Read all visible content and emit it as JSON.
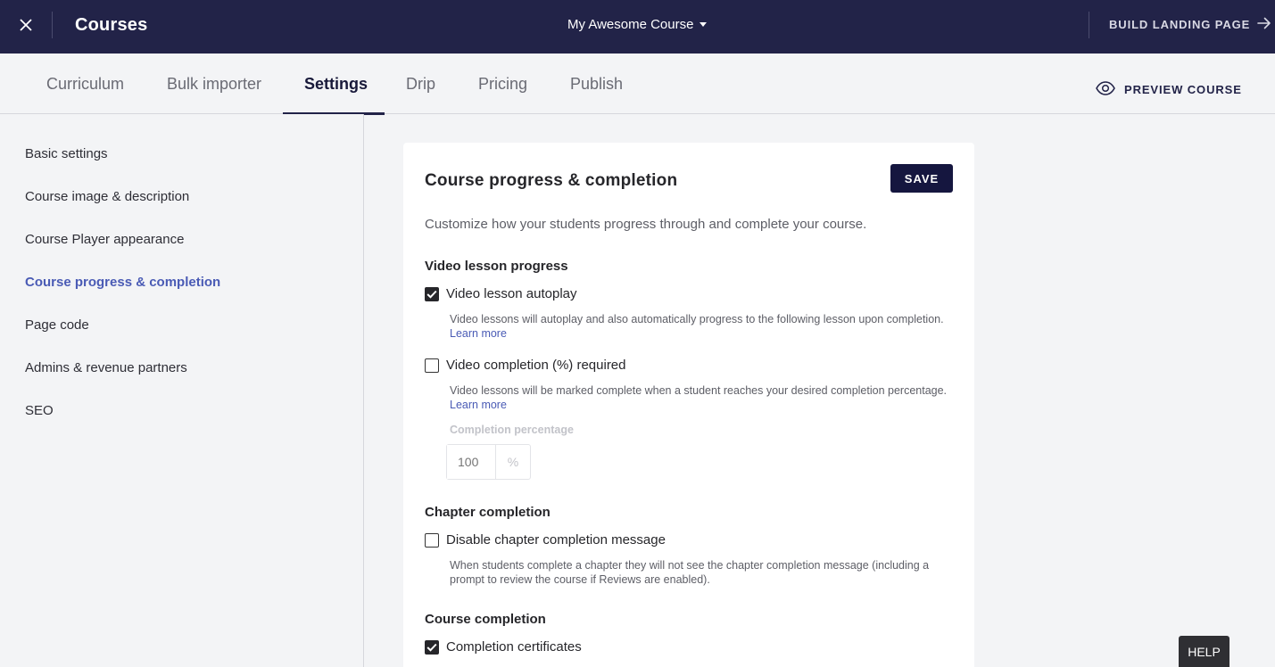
{
  "topbar": {
    "title": "Courses",
    "course_select": "My Awesome Course",
    "build_landing": "BUILD LANDING PAGE"
  },
  "tabs": [
    {
      "label": "Curriculum"
    },
    {
      "label": "Bulk importer"
    },
    {
      "label": "Settings"
    },
    {
      "label": "Drip"
    },
    {
      "label": "Pricing"
    },
    {
      "label": "Publish"
    }
  ],
  "active_tab": "Settings",
  "preview_label": "PREVIEW COURSE",
  "sidebar": {
    "items": [
      {
        "label": "Basic settings"
      },
      {
        "label": "Course image & description"
      },
      {
        "label": "Course Player appearance"
      },
      {
        "label": "Course progress & completion"
      },
      {
        "label": "Page code"
      },
      {
        "label": "Admins & revenue partners"
      },
      {
        "label": "SEO"
      }
    ],
    "active": "Course progress & completion"
  },
  "card": {
    "title": "Course progress & completion",
    "save_label": "SAVE",
    "description": "Customize how your students progress through and complete your course.",
    "video_section": {
      "title": "Video lesson progress",
      "autoplay": {
        "label": "Video lesson autoplay",
        "checked": true,
        "help": "Video lessons will autoplay and also automatically progress to the following lesson upon completion.",
        "learn_more": "Learn more"
      },
      "completion_required": {
        "label": "Video completion (%) required",
        "checked": false,
        "help": "Video lessons will be marked complete when a student reaches your desired completion percentage.",
        "learn_more": "Learn more",
        "pct_label": "Completion percentage",
        "pct_value": "100",
        "pct_suffix": "%"
      }
    },
    "chapter_section": {
      "title": "Chapter completion",
      "disable_message": {
        "label": "Disable chapter completion message",
        "checked": false,
        "help": "When students complete a chapter they will not see the chapter completion message (including a prompt to review the course if Reviews are enabled)."
      }
    },
    "course_section": {
      "title": "Course completion",
      "certificates": {
        "label": "Completion certificates",
        "checked": true
      }
    }
  },
  "help_label": "HELP",
  "colors": {
    "topbar": "#222348",
    "accent": "#4a5bb5",
    "save_button": "#15163f"
  }
}
